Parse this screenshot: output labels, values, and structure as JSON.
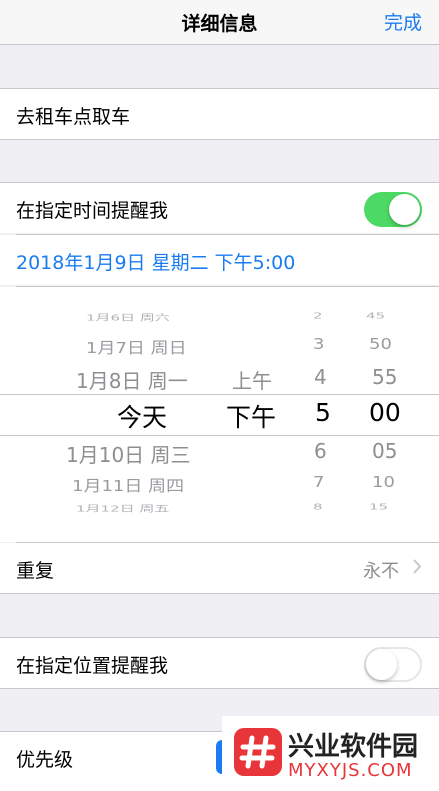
{
  "nav": {
    "title": "详细信息",
    "done_label": "完成"
  },
  "task": {
    "title": "去租车点取车"
  },
  "remind_time": {
    "label": "在指定时间提醒我",
    "enabled": true
  },
  "date_text": "2018年1月9日 星期二 下午5:00",
  "picker": {
    "days": [
      "1月6日 周六",
      "1月7日 周日",
      "1月8日 周一",
      "今天",
      "1月10日 周三",
      "1月11日 周四",
      "1月12日 周五"
    ],
    "ampm": [
      "上午",
      "下午"
    ],
    "hours": [
      "2",
      "3",
      "4",
      "5",
      "6",
      "7",
      "8"
    ],
    "minutes": [
      "45",
      "50",
      "55",
      "00",
      "05",
      "10",
      "15"
    ]
  },
  "repeat": {
    "label": "重复",
    "value": "永不"
  },
  "remind_location": {
    "label": "在指定位置提醒我",
    "enabled": false
  },
  "priority": {
    "label": "优先级"
  },
  "watermark": {
    "title": "兴业软件园",
    "url": "MYXYJS.COM"
  },
  "colors": {
    "accent": "#1a7cf0",
    "toggle_on": "#4cd964",
    "background": "#efeff4"
  }
}
